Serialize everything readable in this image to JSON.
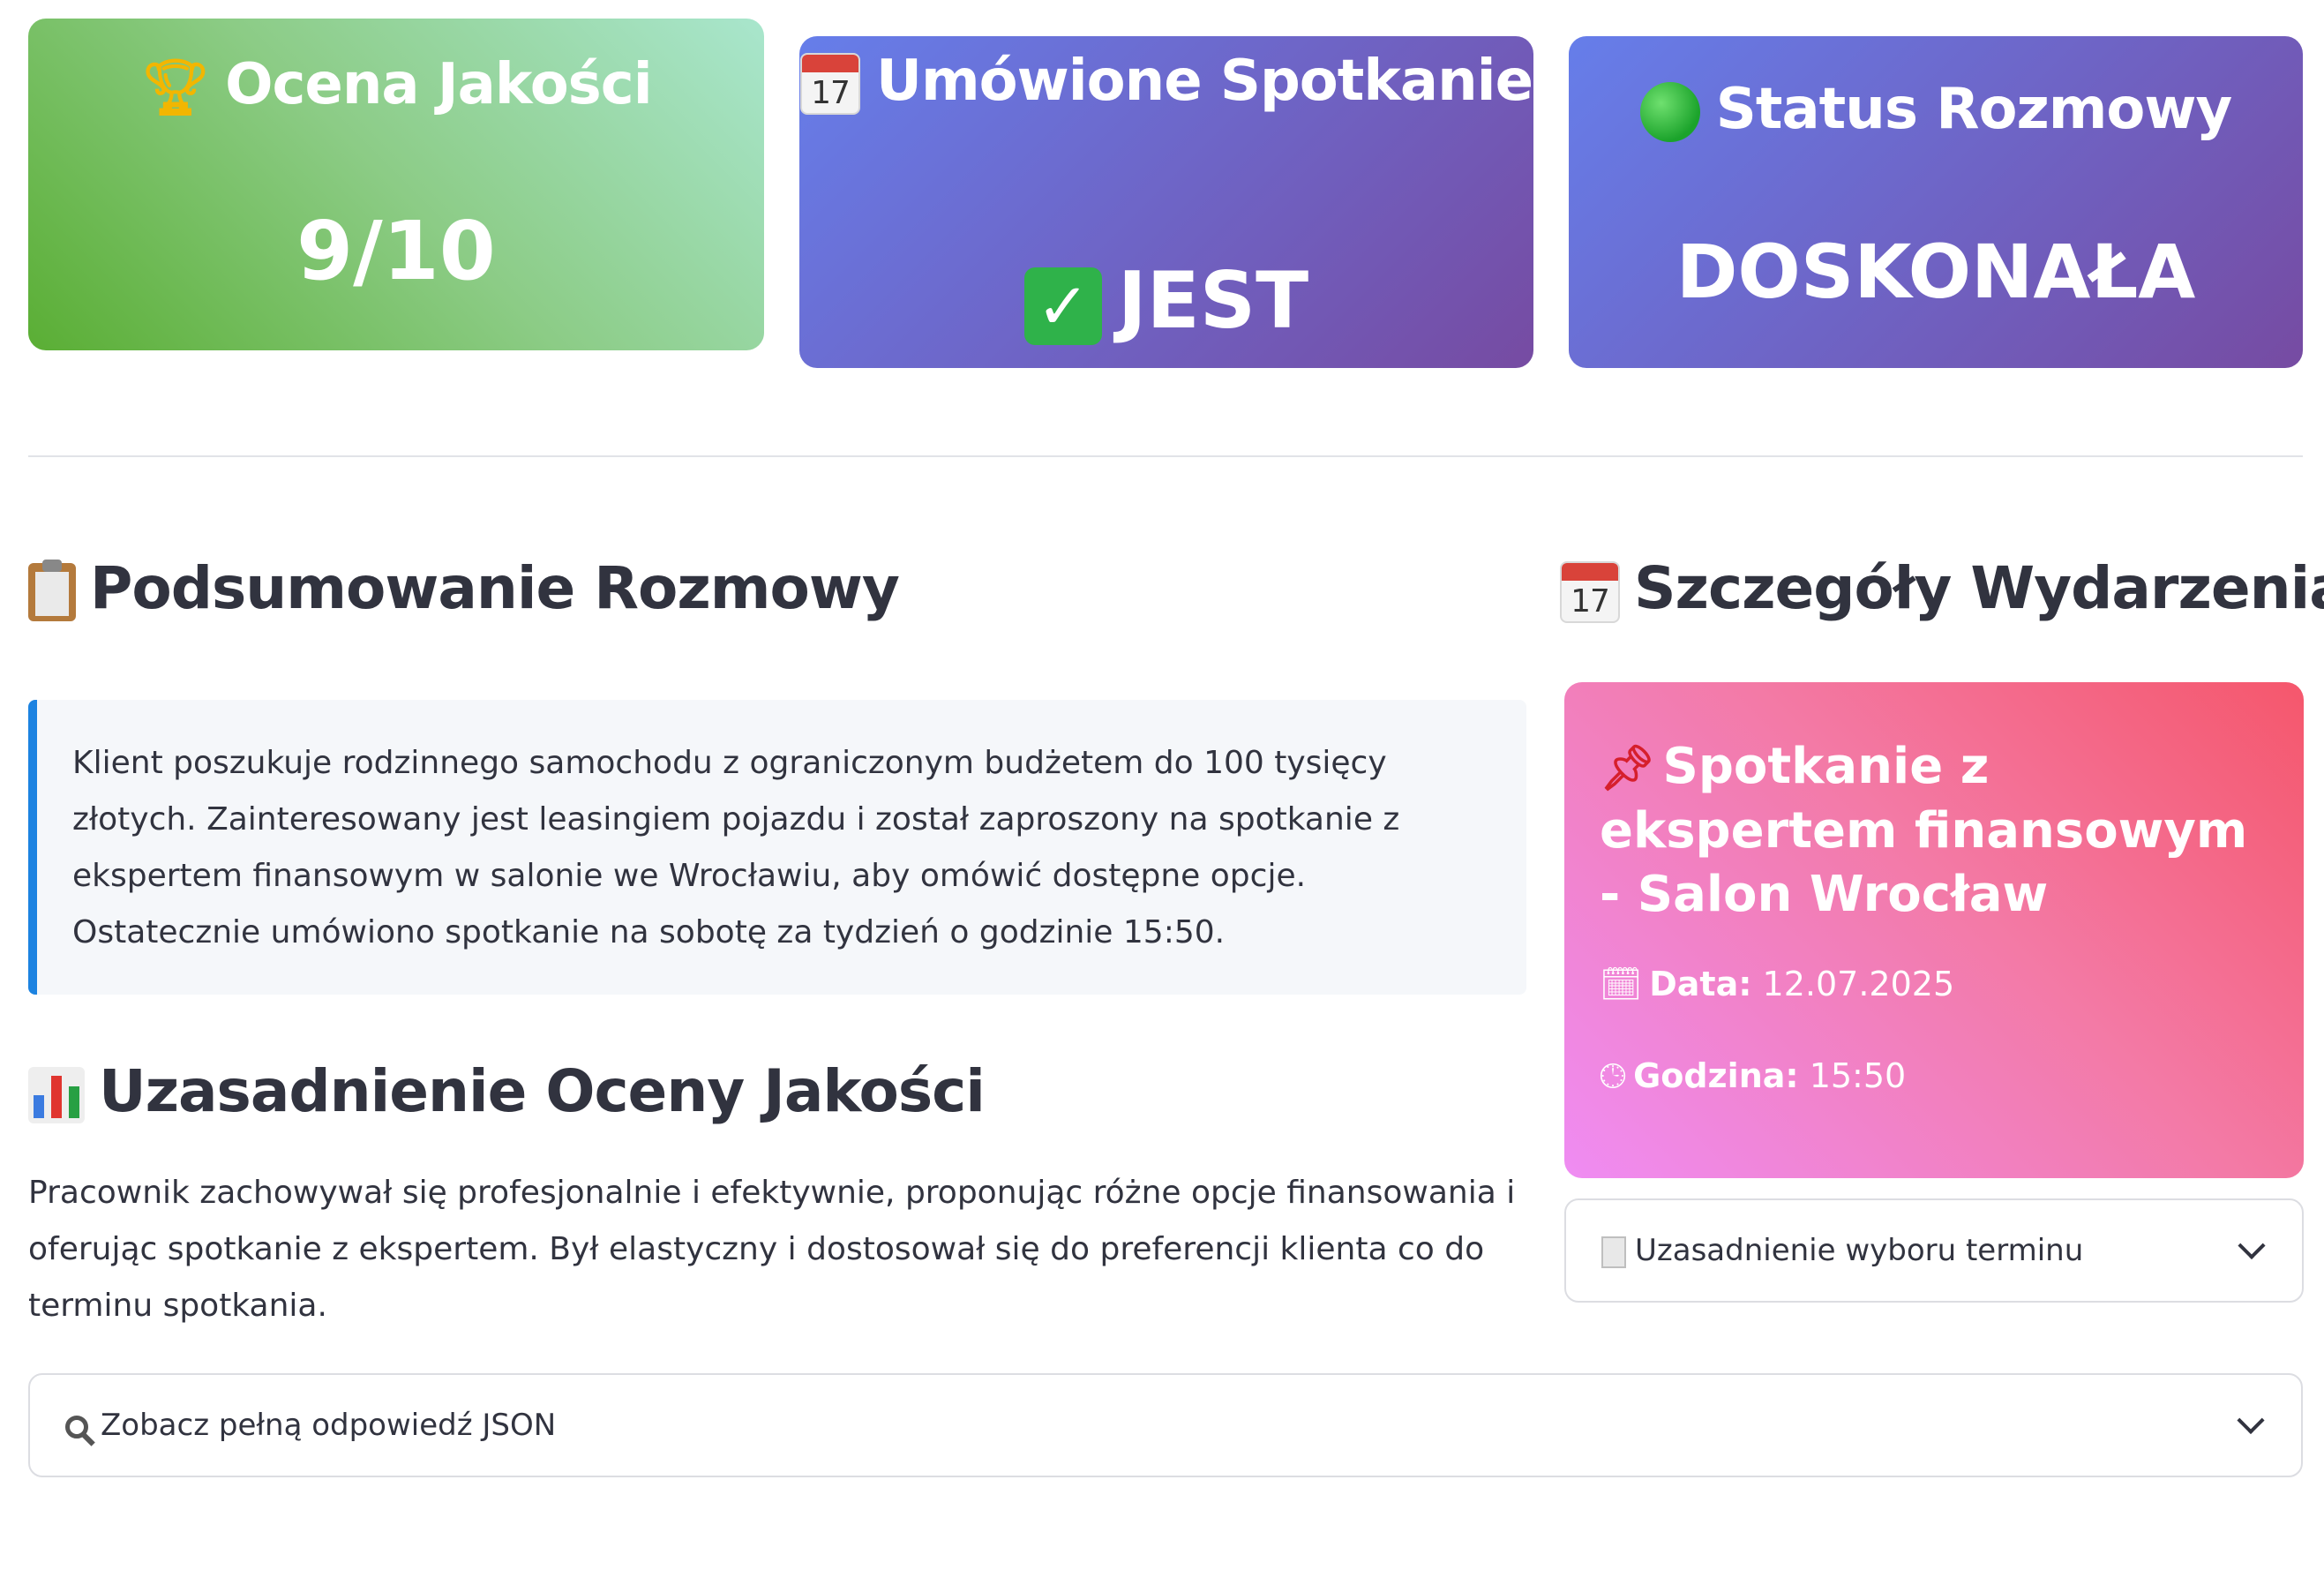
{
  "metrics": {
    "quality": {
      "title": "Ocena Jakości",
      "value": "9/10",
      "icon": "trophy-icon"
    },
    "meeting": {
      "title": "Umówione Spotkanie",
      "value": "JEST",
      "icon": "calendar-icon",
      "value_icon": "check-icon"
    },
    "status": {
      "title": "Status Rozmowy",
      "value": "DOSKONAŁA",
      "icon": "green-circle-icon"
    }
  },
  "summary": {
    "heading": "Podsumowanie Rozmowy",
    "text": "Klient poszukuje rodzinnego samochodu z ograniczonym budżetem do 100 tysięcy złotych. Zainteresowany jest leasingiem pojazdu i został zaproszony na spotkanie z ekspertem finansowym w salonie we Wrocławiu, aby omówić dostępne opcje. Ostatecznie umówiono spotkanie na sobotę za tydzień o godzinie 15:50."
  },
  "justification": {
    "heading": "Uzasadnienie Oceny Jakości",
    "text": "Pracownik zachowywał się profesjonalnie i efektywnie, proponując różne opcje finansowania i oferując spotkanie z ekspertem. Był elastyczny i dostosował się do preferencji klienta co do terminu spotkania."
  },
  "event": {
    "heading": "Szczegóły Wydarzenia",
    "title": "Spotkanie z ekspertem finansowym - Salon Wrocław",
    "date_label": "Data:",
    "date_value": "12.07.2025",
    "time_label": "Godzina:",
    "time_value": "15:50"
  },
  "expanders": {
    "term": "Uzasadnienie wyboru terminu",
    "json": "Zobacz pełną odpowiedź JSON"
  },
  "colors": {
    "accent_blue": "#1c83e1",
    "purple_gradient": [
      "#667eea",
      "#764ba2"
    ],
    "green_gradient": [
      "#5aae34",
      "#a9e6cd"
    ],
    "pink_gradient": [
      "#ef8cf3",
      "#f5576c"
    ]
  }
}
